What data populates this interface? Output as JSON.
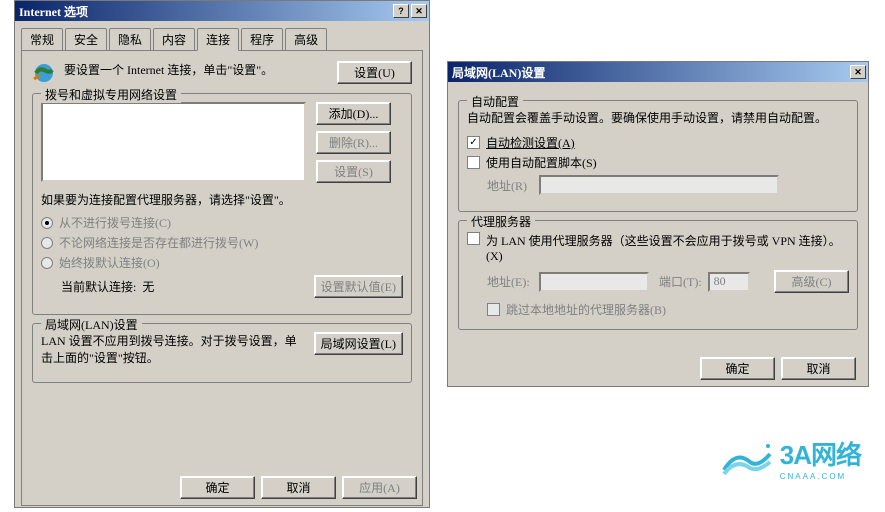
{
  "win1": {
    "title": "Internet 选项",
    "tabs": [
      "常规",
      "安全",
      "隐私",
      "内容",
      "连接",
      "程序",
      "高级"
    ],
    "active_tab": 4,
    "section1_text": "要设置一个 Internet 连接，单击\"设置\"。",
    "section1_btn": "设置(U)",
    "dial_group_title": "拨号和虚拟专用网络设置",
    "dial_add": "添加(D)...",
    "dial_remove": "删除(R)...",
    "dial_settings": "设置(S)",
    "proxy_hint": "如果要为连接配置代理服务器，请选择\"设置\"。",
    "radio_never": "从不进行拨号连接(C)",
    "radio_whenever": "不论网络连接是否存在都进行拨号(W)",
    "radio_always": "始终拨默认连接(O)",
    "current_default_label": "当前默认连接:",
    "current_default_value": "无",
    "set_default_btn": "设置默认值(E)",
    "lan_group_title": "局域网(LAN)设置",
    "lan_hint": "LAN 设置不应用到拨号连接。对于拨号设置，单击上面的\"设置\"按钮。",
    "lan_btn": "局域网设置(L)",
    "ok": "确定",
    "cancel": "取消",
    "apply": "应用(A)"
  },
  "win2": {
    "title": "局域网(LAN)设置",
    "auto_group": "自动配置",
    "auto_hint": "自动配置会覆盖手动设置。要确保使用手动设置，请禁用自动配置。",
    "auto_detect": "自动检测设置(A)",
    "use_script": "使用自动配置脚本(S)",
    "address_label": "地址(R)",
    "proxy_group": "代理服务器",
    "proxy_use": "为 LAN 使用代理服务器（这些设置不会应用于拨号或 VPN 连接）。(X)",
    "proxy_addr": "地址(E):",
    "proxy_port": "端口(T):",
    "proxy_port_val": "80",
    "advanced": "高级(C)",
    "bypass_local": "跳过本地地址的代理服务器(B)",
    "ok": "确定",
    "cancel": "取消"
  },
  "logo": {
    "main": "3A网络",
    "sub": "CNAAA.COM"
  }
}
